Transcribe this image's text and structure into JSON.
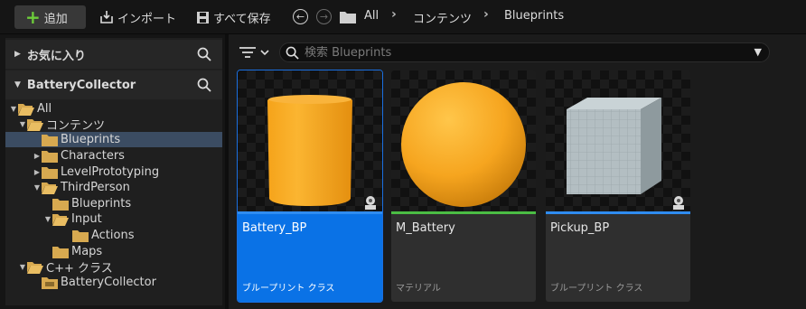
{
  "toolbar": {
    "add_label": "追加",
    "import_label": "インポート",
    "save_all_label": "すべて保存",
    "breadcrumb": [
      "All",
      "コンテンツ",
      "Blueprints"
    ]
  },
  "left_panel": {
    "favorites_title": "お気に入り",
    "project_title": "BatteryCollector",
    "tree": [
      {
        "label": "All",
        "depth": 0,
        "expanded": true,
        "selected": false
      },
      {
        "label": "コンテンツ",
        "depth": 1,
        "expanded": true,
        "selected": false
      },
      {
        "label": "Blueprints",
        "depth": 2,
        "expanded": false,
        "selected": true
      },
      {
        "label": "Characters",
        "depth": 2,
        "expanded": false,
        "selected": false
      },
      {
        "label": "LevelPrototyping",
        "depth": 2,
        "expanded": false,
        "selected": false
      },
      {
        "label": "ThirdPerson",
        "depth": 2,
        "expanded": true,
        "selected": false
      },
      {
        "label": "Blueprints",
        "depth": 3,
        "expanded": false,
        "selected": false
      },
      {
        "label": "Input",
        "depth": 3,
        "expanded": true,
        "selected": false
      },
      {
        "label": "Actions",
        "depth": 4,
        "expanded": false,
        "selected": false
      },
      {
        "label": "Maps",
        "depth": 3,
        "expanded": false,
        "selected": false
      },
      {
        "label": "C++ クラス",
        "depth": 1,
        "expanded": true,
        "selected": false
      },
      {
        "label": "BatteryCollector",
        "depth": 2,
        "expanded": false,
        "selected": false
      }
    ]
  },
  "content": {
    "search_placeholder": "検索 Blueprints",
    "assets": [
      {
        "name": "Battery_BP",
        "type": "ブループリント クラス",
        "selected": true,
        "bar_color": "#2f8cf0"
      },
      {
        "name": "M_Battery",
        "type": "マテリアル",
        "selected": false,
        "bar_color": "#4bbd44"
      },
      {
        "name": "Pickup_BP",
        "type": "ブループリント クラス",
        "selected": false,
        "bar_color": "#2f8cf0"
      }
    ]
  },
  "colors": {
    "accent": "#0a72e6",
    "folder": "#d7a950",
    "asset_orange": "#f2a51e"
  }
}
